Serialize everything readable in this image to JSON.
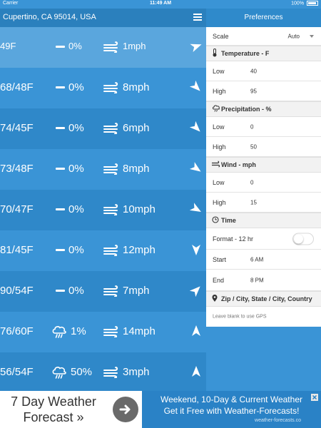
{
  "status_bar": {
    "carrier": "Carrier",
    "time": "11:49 AM",
    "battery": "100%"
  },
  "header": {
    "location": "Cupertino, CA 95014, USA",
    "prefs_title": "Preferences"
  },
  "colors": {
    "row_light": "#3a94d6",
    "row_dark": "#2f88c9",
    "row_first": "#5aa6dd",
    "header": "#2b80bd",
    "ad_blue": "#2a82c6"
  },
  "forecast_rows": [
    {
      "temp": "49F",
      "precip": "0%",
      "precip_icon": "dash-icon",
      "wind": "1mph",
      "dir_angle": 70
    },
    {
      "temp": "68/48F",
      "precip": "0%",
      "precip_icon": "dash-icon",
      "wind": "8mph",
      "dir_angle": 135
    },
    {
      "temp": "74/45F",
      "precip": "0%",
      "precip_icon": "dash-icon",
      "wind": "6mph",
      "dir_angle": 135
    },
    {
      "temp": "73/48F",
      "precip": "0%",
      "precip_icon": "dash-icon",
      "wind": "8mph",
      "dir_angle": 125
    },
    {
      "temp": "70/47F",
      "precip": "0%",
      "precip_icon": "dash-icon",
      "wind": "10mph",
      "dir_angle": 120
    },
    {
      "temp": "81/45F",
      "precip": "0%",
      "precip_icon": "dash-icon",
      "wind": "12mph",
      "dir_angle": 180
    },
    {
      "temp": "90/54F",
      "precip": "0%",
      "precip_icon": "dash-icon",
      "wind": "7mph",
      "dir_angle": 45
    },
    {
      "temp": "76/60F",
      "precip": "1%",
      "precip_icon": "rain-cloud-icon",
      "wind": "14mph",
      "dir_angle": 0
    },
    {
      "temp": "56/54F",
      "precip": "50%",
      "precip_icon": "rain-cloud-icon",
      "wind": "3mph",
      "dir_angle": 0
    }
  ],
  "prefs": {
    "scale_label": "Scale",
    "scale_value": "Auto",
    "temperature": {
      "title": "Temperature - F",
      "low_label": "Low",
      "low": "40",
      "high_label": "High",
      "high": "95"
    },
    "precipitation": {
      "title": "Precipitation - %",
      "low_label": "Low",
      "low": "0",
      "high_label": "High",
      "high": "50"
    },
    "wind": {
      "title": "Wind - mph",
      "low_label": "Low",
      "low": "0",
      "high_label": "High",
      "high": "15"
    },
    "time": {
      "title": "Time",
      "format_label": "Format - 12 hr",
      "format_24hr_on": false,
      "start_label": "Start",
      "start": "6 AM",
      "end_label": "End",
      "end": "8 PM"
    },
    "location": {
      "title": "Zip / City, State / City, Country",
      "placeholder": "Leave blank to use GPS"
    }
  },
  "ad": {
    "left_line1": "7 Day Weather",
    "left_line2": "Forecast »",
    "right_line1": "Weekend, 10-Day & Current Weather",
    "right_line2": "Get it Free with Weather-Forecasts!",
    "source": "weather-forecasts.co"
  }
}
